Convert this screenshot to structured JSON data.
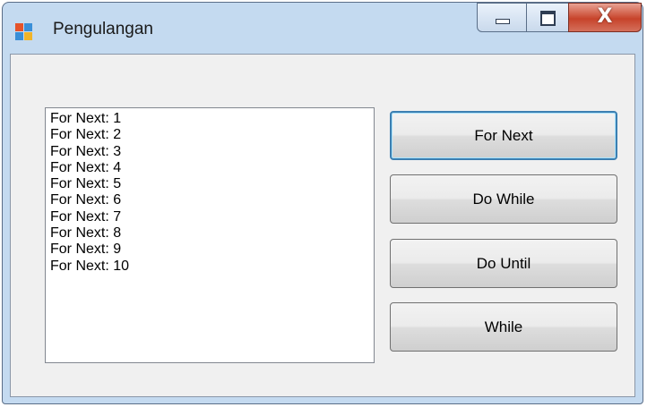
{
  "window": {
    "title": "Pengulangan",
    "icon": "app-form-icon",
    "controls": {
      "minimize": "minimize-icon",
      "maximize": "maximize-icon",
      "close": "X"
    }
  },
  "list": {
    "items": [
      "For Next: 1",
      "For Next: 2",
      "For Next: 3",
      "For Next: 4",
      "For Next: 5",
      "For Next: 6",
      "For Next: 7",
      "For Next: 8",
      "For Next: 9",
      "For Next: 10"
    ]
  },
  "buttons": {
    "for_next": "For Next",
    "do_while": "Do While",
    "do_until": "Do Until",
    "while": "While"
  },
  "colors": {
    "frame": "#c4daf0",
    "client": "#f0f0f0",
    "close_button": "#c7432a",
    "focus_border": "#3c7fb1"
  }
}
